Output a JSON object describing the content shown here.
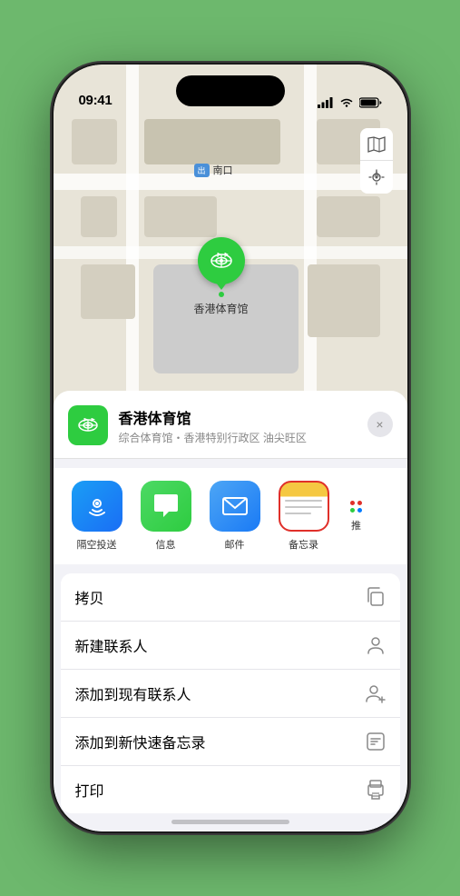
{
  "statusBar": {
    "time": "09:41",
    "signal": "●●●●",
    "wifi": "wifi",
    "battery": "battery"
  },
  "map": {
    "southLabel": "南口",
    "southTag": "出",
    "stadiumName": "香港体育馆"
  },
  "locationHeader": {
    "name": "香港体育馆",
    "subtitle": "综合体育馆・香港特别行政区 油尖旺区",
    "closeLabel": "×"
  },
  "shareApps": [
    {
      "id": "airdrop",
      "label": "隔空投送",
      "emoji": "📡"
    },
    {
      "id": "messages",
      "label": "信息",
      "emoji": "💬"
    },
    {
      "id": "mail",
      "label": "邮件",
      "emoji": "✉️"
    },
    {
      "id": "notes",
      "label": "备忘录",
      "selected": true
    },
    {
      "id": "more",
      "label": "推"
    }
  ],
  "actions": [
    {
      "id": "copy",
      "label": "拷贝",
      "icon": "copy"
    },
    {
      "id": "new-contact",
      "label": "新建联系人",
      "icon": "person"
    },
    {
      "id": "add-existing",
      "label": "添加到现有联系人",
      "icon": "person-add"
    },
    {
      "id": "quick-note",
      "label": "添加到新快速备忘录",
      "icon": "note"
    },
    {
      "id": "print",
      "label": "打印",
      "icon": "print"
    }
  ]
}
